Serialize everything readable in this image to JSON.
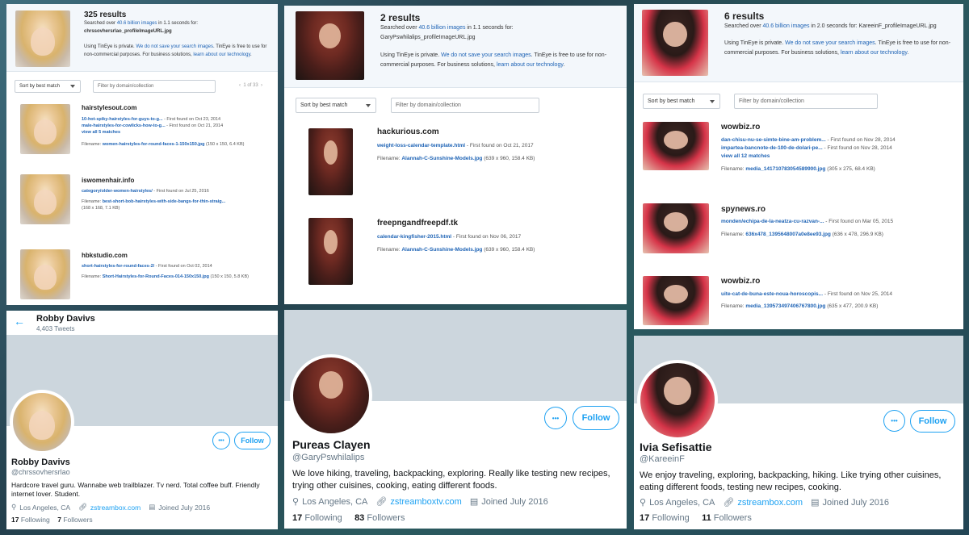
{
  "tineye": [
    {
      "count": "325 results",
      "searched_prefix": "Searched over ",
      "searched_link": "40.6 billion images",
      "searched_suffix": " in 1.1 seconds for:",
      "filename": "chrssovhersrlao_profileImageURL.jpg",
      "privacy_prefix": "Using TinEye is private. ",
      "privacy_link": "We do not save your search images",
      "privacy_mid": ". TinEye is free to use for non-commercial purposes. For business solutions, ",
      "privacy_link2": "learn about our technology",
      "privacy_end": ".",
      "sort_label": "Sort by best match",
      "filter_placeholder": "Filter by domain/collection",
      "pager": "1 of 33",
      "results": [
        {
          "domain": "hairstylesout.com",
          "lines": [
            {
              "link": "10-hot-spiky-hairstyles-for-guys-to-g...",
              "text": " - First found on Oct 23, 2014"
            },
            {
              "link": "male-hairstyles-for-cowlicks-how-to-g...",
              "text": " - First found on Oct 21, 2014"
            },
            {
              "link": "view all 5 matches",
              "text": ""
            },
            {
              "label": "Filename: ",
              "link": "women-hairstyles-for-round-faces-1-150x150.jpg",
              "text": " (150 x 150, 6.4 KB)"
            }
          ]
        },
        {
          "domain": "iswomenhair.info",
          "lines": [
            {
              "link": "category/older-women-hairstyles/",
              "text": " - First found on Jul 25, 2016"
            },
            {
              "label": "Filename: ",
              "link": "best-short-bob-hairstyles-with-side-bangs-for-thin-straig...",
              "text": ""
            },
            {
              "link": "",
              "text": "(168 x 168, 7.1 KB)"
            }
          ]
        },
        {
          "domain": "hbkstudio.com",
          "lines": [
            {
              "link": "short-hairstyles-for-round-faces-2/",
              "text": " - First found on Oct 02, 2014"
            },
            {
              "label": "Filename: ",
              "link": "Short-Hairstyles-for-Round-Faces-014-150x150.jpg",
              "text": " (150 x 150, 5.8 KB)"
            }
          ]
        }
      ]
    },
    {
      "count": "2 results",
      "searched_prefix": "Searched over ",
      "searched_link": "40.6 billion images",
      "searched_suffix": " in 1.1 seconds for:",
      "filename": "GaryPswhilalips_profileImageURL.jpg",
      "privacy_prefix": "Using TinEye is private. ",
      "privacy_link": "We do not save your search images",
      "privacy_mid": ". TinEye is free to use for non-commercial purposes. For business solutions, ",
      "privacy_link2": "learn about our technology",
      "privacy_end": ".",
      "sort_label": "Sort by best match",
      "filter_placeholder": "Filter by domain/collection",
      "results": [
        {
          "domain": "hackurious.com",
          "lines": [
            {
              "link": "weight-loss-calendar-template.html",
              "text": " - First found on Oct 21, 2017"
            },
            {
              "label": "Filename: ",
              "link": "Alannah-C-Sunshine-Models.jpg",
              "text": " (639 x 960, 158.4 KB)"
            }
          ]
        },
        {
          "domain": "freepngandfreepdf.tk",
          "lines": [
            {
              "link": "calendar-kingfisher-2015.html",
              "text": " - First found on Nov 06, 2017"
            },
            {
              "label": "Filename: ",
              "link": "Alannah-C-Sunshine-Models.jpg",
              "text": " (639 x 960, 158.4 KB)"
            }
          ]
        }
      ]
    },
    {
      "count": "6 results",
      "searched_prefix": "Searched over ",
      "searched_link": "40.6 billion images",
      "searched_suffix": " in 2.0 seconds for:",
      "filename": "KareeinF_profileImageURL.jpg",
      "privacy_prefix": "Using TinEye is private. ",
      "privacy_link": "We do not save your search images",
      "privacy_mid": ". TinEye is free to use for non-commercial purposes. For business solutions, ",
      "privacy_link2": "learn about our technology",
      "privacy_end": ".",
      "sort_label": "Sort by best match",
      "filter_placeholder": "Filter by domain/collection",
      "results": [
        {
          "domain": "wowbiz.ro",
          "lines": [
            {
              "link": "dan-chisu-nu-se-simte-bine-am-problem...",
              "text": " - First found on Nov 28, 2014"
            },
            {
              "link": "impartea-bancnote-de-100-de-dolari-pe...",
              "text": " - First found on Nov 28, 2014"
            },
            {
              "link": "view all 12 matches",
              "text": ""
            },
            {
              "label": "Filename: ",
              "link": "media_141710783054589900.jpg",
              "text": " (305 x 275, 68.4 KB)"
            }
          ]
        },
        {
          "domain": "spynews.ro",
          "lines": [
            {
              "link": "monden/echipa-de-la-neatza-cu-razvan-...",
              "text": " - First found on Mar 05, 2015"
            },
            {
              "label": "Filename: ",
              "link": "636x478_1395648007a0e8ee93.jpg",
              "text": " (636 x 478, 296.9 KB)"
            }
          ]
        },
        {
          "domain": "wowbiz.ro",
          "lines": [
            {
              "link": "uite-cat-de-buna-este-noua-horoscopis...",
              "text": " - First found on Nov 25, 2014"
            },
            {
              "label": "Filename: ",
              "link": "media_139573497406767800.jpg",
              "text": " (635 x 477, 200.9 KB)"
            }
          ]
        }
      ]
    }
  ],
  "twitter": [
    {
      "header_name": "Robby Davivs",
      "header_tweets": "4,403 Tweets",
      "name": "Robby Davivs",
      "handle": "@chrssovhersrlao",
      "bio": "Hardcore travel guru. Wannabe web trailblazer. Tv nerd. Total coffee buff. Friendly internet lover. Student.",
      "location": "Los Angeles, CA",
      "url": "zstreambox.com",
      "joined": "Joined July 2016",
      "following_count": "17",
      "following_label": "Following",
      "followers_count": "7",
      "followers_label": "Followers",
      "follow_label": "Follow",
      "more_label": "•••",
      "back_label": "←"
    },
    {
      "name": "Pureas Clayen",
      "handle": "@GaryPswhilalips",
      "bio": "We love hiking, traveling, backpacking, exploring. Really like testing new recipes, trying other cuisines, cooking, eating different foods.",
      "location": "Los Angeles, CA",
      "url": "zstreamboxtv.com",
      "joined": "Joined July 2016",
      "following_count": "17",
      "following_label": "Following",
      "followers_count": "83",
      "followers_label": "Followers",
      "follow_label": "Follow",
      "more_label": "•••"
    },
    {
      "name": "Ivia Sefisattie",
      "handle": "@KareeinF",
      "bio": "We enjoy traveling, exploring, backpacking, hiking. Like trying other cuisines, eating different foods, testing new recipes, cooking.",
      "location": "Los Angeles, CA",
      "url": "zstreambox.com",
      "joined": "Joined July 2016",
      "following_count": "17",
      "following_label": "Following",
      "followers_count": "11",
      "followers_label": "Followers",
      "follow_label": "Follow",
      "more_label": "•••"
    }
  ],
  "icons": {
    "location": "map-pin-icon",
    "link": "link-icon",
    "calendar": "calendar-icon"
  },
  "colors": {
    "tineye_link": "#1e63b5",
    "twitter_blue": "#1da1f2",
    "banner": "#ccd6dd"
  }
}
